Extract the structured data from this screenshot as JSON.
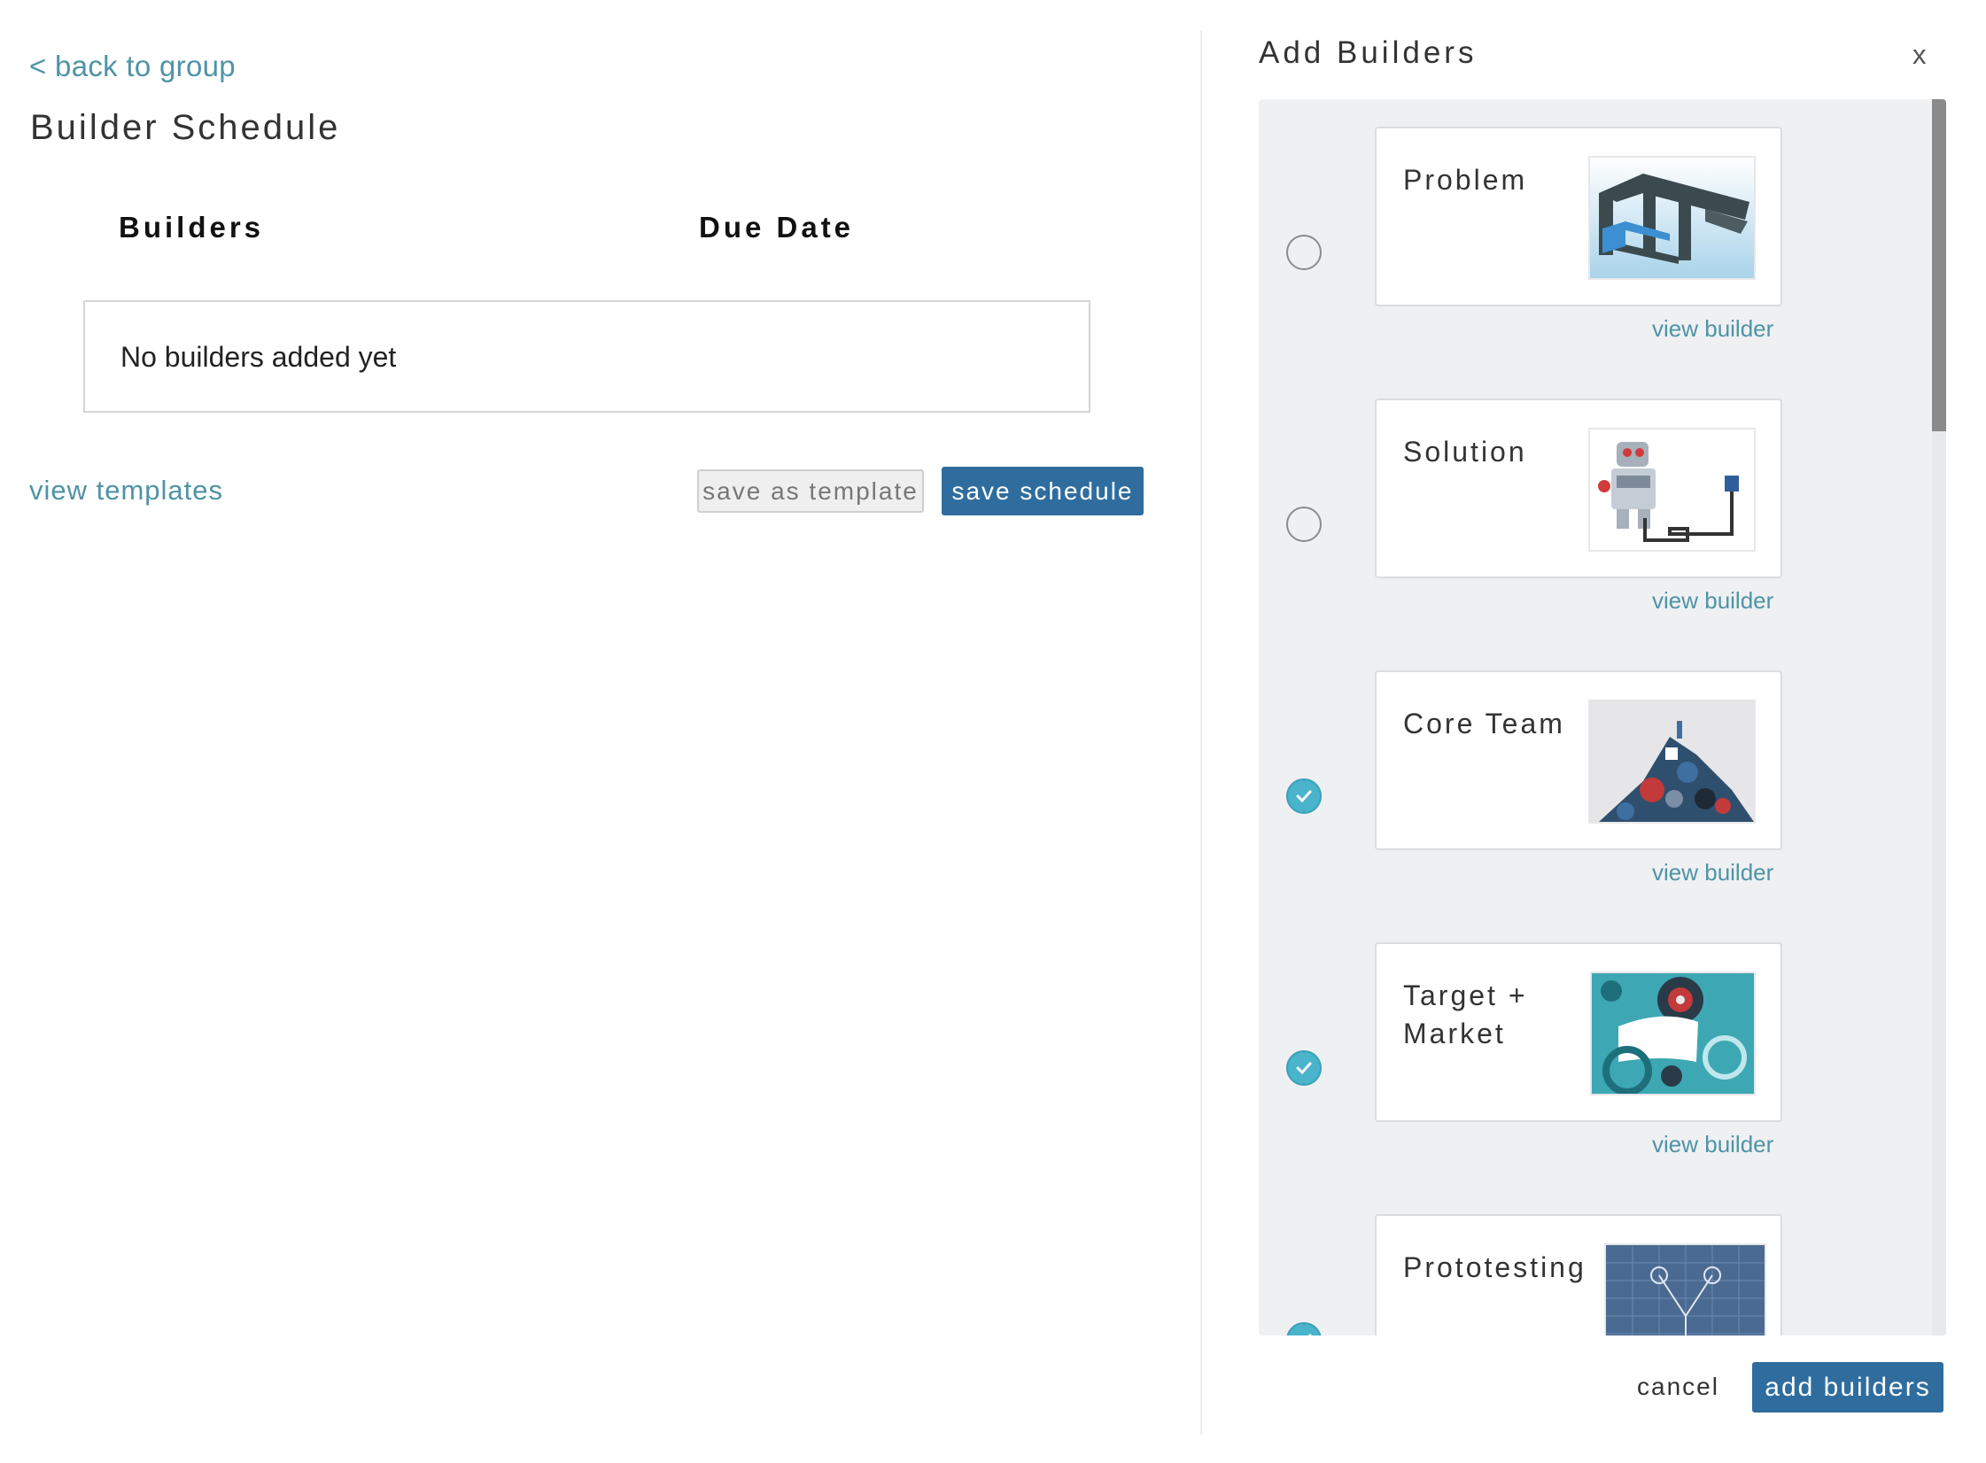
{
  "nav": {
    "back_link": "< back to group"
  },
  "page": {
    "title": "Builder Schedule"
  },
  "table": {
    "columns": [
      "Builders",
      "Due Date"
    ],
    "empty_message": "No builders added yet"
  },
  "actions": {
    "view_templates": "view templates",
    "save_as_template": "save as template",
    "save_schedule": "save schedule"
  },
  "modal": {
    "title": "Add Builders",
    "close": "x",
    "view_builder_label": "view builder",
    "builders": [
      {
        "title": "Problem",
        "selected": false,
        "thumbnail_icon": "frame-structure-illustration"
      },
      {
        "title": "Solution",
        "selected": false,
        "thumbnail_icon": "robot-illustration"
      },
      {
        "title": "Core Team",
        "selected": true,
        "thumbnail_icon": "pile-of-objects-illustration"
      },
      {
        "title": "Target + Market",
        "selected": true,
        "thumbnail_icon": "teal-target-illustration"
      },
      {
        "title": "Prototesting",
        "selected": true,
        "thumbnail_icon": "blueprint-sketch-illustration"
      }
    ],
    "cancel": "cancel",
    "add_builders": "add builders"
  },
  "colors": {
    "link": "#4f93a6",
    "primary_button": "#2f6d9e",
    "checked_radio": "#49b4cc",
    "list_background": "#eff0f2"
  }
}
